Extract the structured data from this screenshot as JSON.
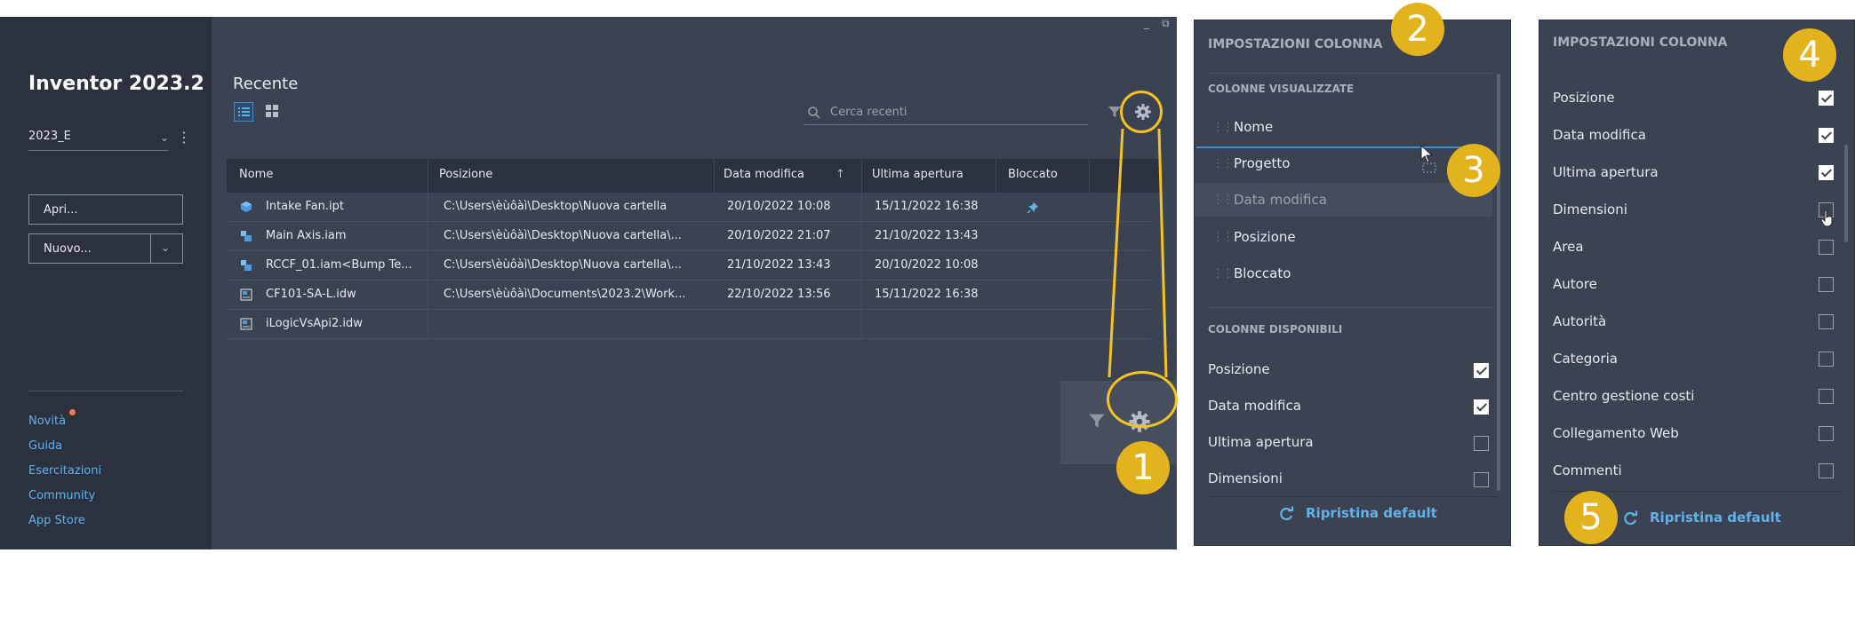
{
  "app": {
    "title": "Inventor 2023.2",
    "project_select": "2023_E",
    "open_button": "Apri...",
    "new_button": "Nuovo...",
    "links": [
      "Novità",
      "Guida",
      "Esercitazioni",
      "Community",
      "App Store"
    ],
    "notification_color": "#f07d4b"
  },
  "main": {
    "section_title": "Recente",
    "search_placeholder": "Cerca recenti",
    "window_controls": [
      "_",
      "⧉"
    ],
    "table": {
      "headers": [
        "Nome",
        "Posizione",
        "Data modifica",
        "Ultima apertura",
        "Bloccato"
      ],
      "sort_indicator": "↑",
      "rows": [
        {
          "icon": "part-file-icon",
          "name": "Intake Fan.ipt",
          "location": "C:\\Users\\èùôàì\\Desktop\\Nuova cartella",
          "modified": "20/10/2022 10:08",
          "opened": "15/11/2022 16:38",
          "pinned": true
        },
        {
          "icon": "assembly-file-icon",
          "name": "Main Axis.iam",
          "location": "C:\\Users\\èùôàì\\Desktop\\Nuova cartella\\...",
          "modified": "20/10/2022 21:07",
          "opened": "21/10/2022 13:43",
          "pinned": false
        },
        {
          "icon": "assembly-file-icon",
          "name": "RCCF_01.iam<Bump Te...",
          "location": "C:\\Users\\èùôàì\\Desktop\\Nuova cartella\\...",
          "modified": "21/10/2022 13:43",
          "opened": "20/10/2022 10:08",
          "pinned": false
        },
        {
          "icon": "drawing-file-icon",
          "name": "CF101-SA-L.idw",
          "location": "C:\\Users\\èùôàì\\Documents\\2023.2\\Work...",
          "modified": "22/10/2022 13:56",
          "opened": "15/11/2022 16:38",
          "pinned": false
        },
        {
          "icon": "drawing-file-icon",
          "name": "iLogicVsApi2.idw",
          "location": "",
          "modified": "",
          "opened": "",
          "pinned": false
        }
      ]
    }
  },
  "panel_2": {
    "title": "IMPOSTAZIONI COLONNA",
    "shown_header": "COLONNE VISUALIZZATE",
    "shown_columns": [
      "Nome",
      "Progetto",
      "Data modifica",
      "Posizione",
      "Bloccato"
    ],
    "available_header": "COLONNE DISPONIBILI",
    "available_columns": [
      {
        "label": "Posizione",
        "checked": true
      },
      {
        "label": "Data modifica",
        "checked": true
      },
      {
        "label": "Ultima apertura",
        "checked": false
      },
      {
        "label": "Dimensioni",
        "checked": false
      }
    ],
    "reset_label": "Ripristina default"
  },
  "panel_4": {
    "title": "IMPOSTAZIONI COLONNA",
    "columns": [
      {
        "label": "Posizione",
        "checked": true
      },
      {
        "label": "Data modifica",
        "checked": true
      },
      {
        "label": "Ultima apertura",
        "checked": true
      },
      {
        "label": "Dimensioni",
        "checked": false
      },
      {
        "label": "Area",
        "checked": false
      },
      {
        "label": "Autore",
        "checked": false
      },
      {
        "label": "Autorità",
        "checked": false
      },
      {
        "label": "Categoria",
        "checked": false
      },
      {
        "label": "Centro gestione costi",
        "checked": false
      },
      {
        "label": "Collegamento Web",
        "checked": false
      },
      {
        "label": "Commenti",
        "checked": false
      }
    ],
    "reset_label": "Ripristina default"
  },
  "callouts": [
    "1",
    "2",
    "3",
    "4",
    "5"
  ],
  "colors": {
    "accent": "#5fb3e8",
    "callout": "#e3b31d",
    "callout_ring": "#f5c320",
    "background": "#3b4252",
    "sidebar": "#2c3140"
  }
}
